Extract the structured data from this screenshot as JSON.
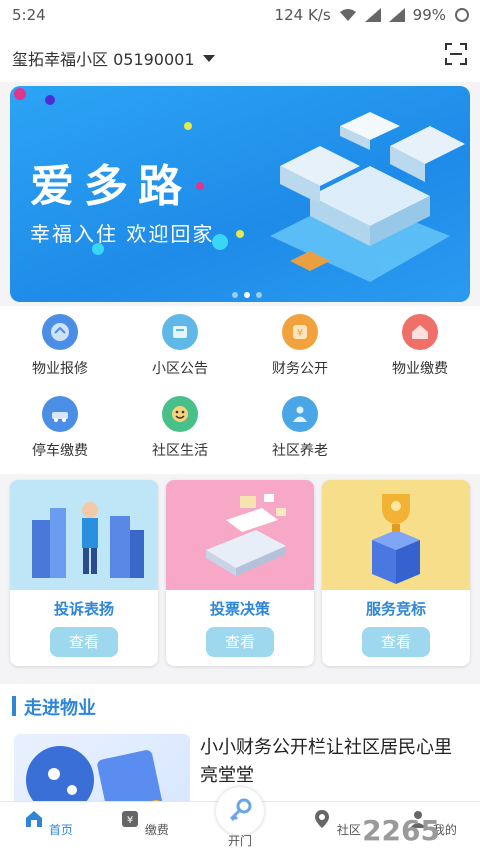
{
  "status": {
    "time": "5:24",
    "speed": "124 K/s",
    "battery": "99%"
  },
  "header": {
    "community": "玺拓幸福小区 05190001",
    "scan_icon": "scan-icon"
  },
  "banner": {
    "title": "爱多路",
    "subtitle": "幸福入住  欢迎回家",
    "dots": 3,
    "active_dot": 1
  },
  "grid": {
    "items": [
      {
        "label": "物业报修",
        "icon": "repair-icon",
        "color": "#4a8ee6"
      },
      {
        "label": "小区公告",
        "icon": "notice-icon",
        "color": "#5fb8e6"
      },
      {
        "label": "财务公开",
        "icon": "finance-icon",
        "color": "#f2a23c"
      },
      {
        "label": "物业缴费",
        "icon": "house-pay-icon",
        "color": "#f07068"
      },
      {
        "label": "停车缴费",
        "icon": "car-icon",
        "color": "#4a8ee6"
      },
      {
        "label": "社区生活",
        "icon": "smile-icon",
        "color": "#48c08a"
      },
      {
        "label": "社区养老",
        "icon": "elder-icon",
        "color": "#4aa6e6"
      }
    ]
  },
  "cards": [
    {
      "title": "投诉表扬",
      "button": "查看",
      "bg": "#bfe6f7"
    },
    {
      "title": "投票决策",
      "button": "查看",
      "bg": "#f6a8c6"
    },
    {
      "title": "服务竞标",
      "button": "查看",
      "bg": "#f6de8b"
    }
  ],
  "section": {
    "title": "走进物业",
    "news_title": "小小财务公开栏让社区居民心里亮堂堂"
  },
  "tabs": [
    {
      "label": "首页",
      "icon": "home-icon",
      "active": true
    },
    {
      "label": "缴费",
      "icon": "payment-icon",
      "active": false
    },
    {
      "label": "开门",
      "icon": "key-icon",
      "active": false
    },
    {
      "label": "社区",
      "icon": "community-icon",
      "active": false
    },
    {
      "label": "我的",
      "icon": "user-icon",
      "active": false
    }
  ],
  "watermark": "2265"
}
